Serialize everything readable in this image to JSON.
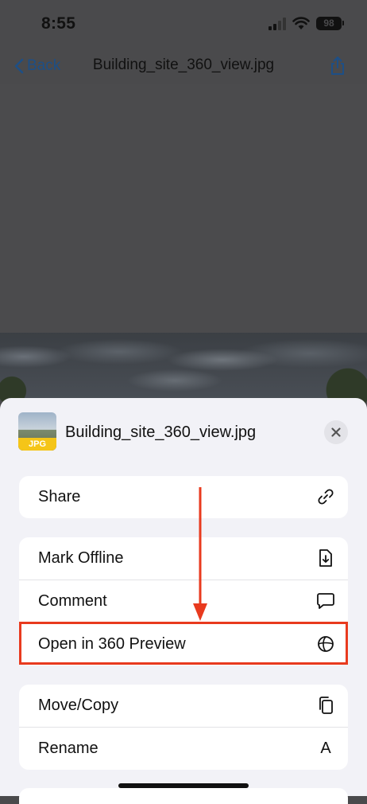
{
  "status_bar": {
    "time": "8:55",
    "battery": "98"
  },
  "nav": {
    "back_label": "Back",
    "title": "Building_site_360_view.jpg"
  },
  "sheet": {
    "file_name": "Building_site_360_view.jpg",
    "file_type_badge": "JPG",
    "groups": [
      {
        "items": [
          {
            "label": "Share",
            "icon": "link-icon"
          }
        ]
      },
      {
        "items": [
          {
            "label": "Mark Offline",
            "icon": "download-document-icon"
          },
          {
            "label": "Comment",
            "icon": "speech-bubble-icon"
          },
          {
            "label": "Open in 360 Preview",
            "icon": "globe-360-icon"
          }
        ]
      },
      {
        "items": [
          {
            "label": "Move/Copy",
            "icon": "copy-icon"
          },
          {
            "label": "Rename",
            "icon": "text-a-icon",
            "glyph": "A"
          }
        ]
      }
    ]
  },
  "annotation": {
    "highlight_color": "#e83a1e",
    "highlighted_item": "Open in 360 Preview"
  },
  "colors": {
    "accent": "#1d4f86",
    "sheet_bg": "#f2f2f7",
    "dim_bg": "#4a4a4c"
  }
}
